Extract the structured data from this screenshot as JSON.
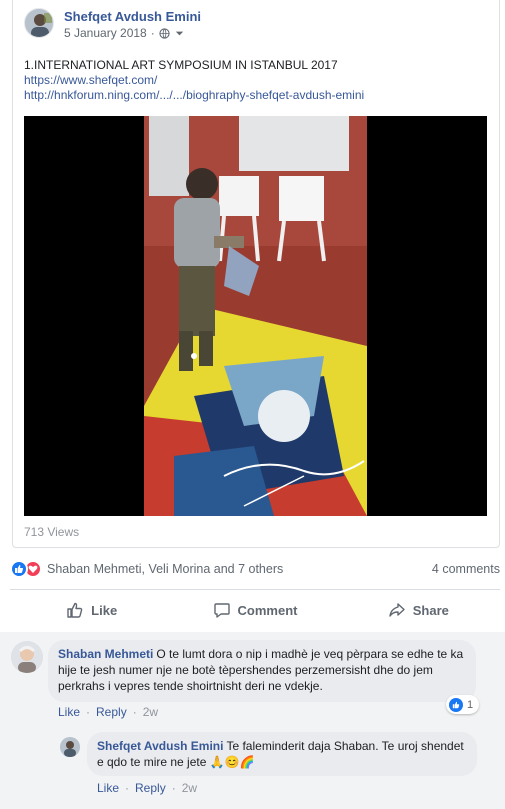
{
  "post": {
    "author": "Shefqet Avdush Emini",
    "date": "5 January 2018",
    "privacy_icon": "globe-icon",
    "menu_icon": "chevron-down-icon",
    "text_line": "1.INTERNATIONAL ART SYMPOSIUM IN ISTANBUL 2017",
    "link1": "https://www.shefqet.com/",
    "link2": "http://hnkforum.ning.com/.../.../bioghraphy-shefqet-avdush-emini",
    "views": "713 Views"
  },
  "reactions": {
    "icons": [
      "like-reaction-icon",
      "love-reaction-icon"
    ],
    "names": "Shaban Mehmeti, Veli Morina and 7 others",
    "comments_count": "4 comments"
  },
  "actions": {
    "like": "Like",
    "comment": "Comment",
    "share": "Share"
  },
  "comments": [
    {
      "name": "Shaban Mehmeti",
      "text": "O te lumt dora o nip i madhè je veq pèrpara se edhe te ka hije te jesh numer nje ne botè tèpershendes perzemersisht dhe do jem perkrahs i vepres tende shoirtnisht deri ne vdekje.",
      "like": "Like",
      "reply": "Reply",
      "time": "2w",
      "reaction_count": "1"
    },
    {
      "name": "Shefqet Avdush Emini",
      "text": "Te faleminderit daja Shaban. Te uroj shendet e qdo te mire ne jete",
      "emojis": "🙏😊🌈",
      "like": "Like",
      "reply": "Reply",
      "time": "2w"
    }
  ],
  "colors": {
    "link": "#385898",
    "like_blue": "#1877f2",
    "love_red": "#f33e58",
    "muted": "#606770"
  }
}
